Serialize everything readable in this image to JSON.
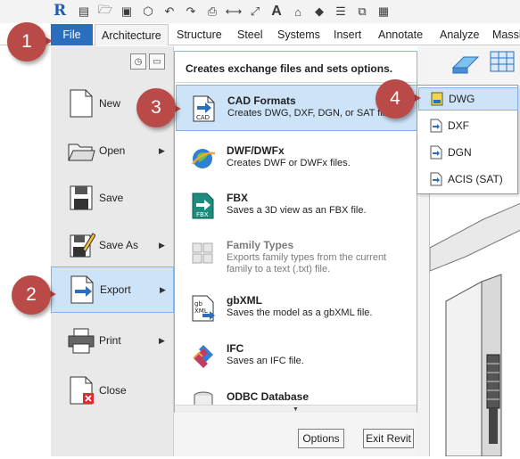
{
  "quick_access": {
    "logo": "R",
    "icons": [
      "open-file-icon",
      "open-folder-icon",
      "save-icon",
      "sync-icon",
      "undo-icon",
      "redo-icon",
      "print-icon",
      "measure-icon",
      "dimension-icon",
      "text-icon",
      "3d-view-icon",
      "section-icon",
      "thin-lines-icon",
      "close-views-icon",
      "switch-windows-icon"
    ]
  },
  "ribbon": {
    "file_tab": "File",
    "tabs": [
      "Architecture",
      "Structure",
      "Steel",
      "Systems",
      "Insert",
      "Annotate",
      "Analyze",
      "Massi"
    ]
  },
  "app_menu": {
    "items": [
      {
        "label": "New",
        "has_arrow": false
      },
      {
        "label": "Open",
        "has_arrow": true
      },
      {
        "label": "Save",
        "has_arrow": false
      },
      {
        "label": "Save As",
        "has_arrow": true
      },
      {
        "label": "Export",
        "has_arrow": true
      },
      {
        "label": "Print",
        "has_arrow": true
      },
      {
        "label": "Close",
        "has_arrow": false
      }
    ],
    "selected": "Export"
  },
  "export_menu": {
    "header": "Creates exchange files and sets options.",
    "items": [
      {
        "title": "CAD Formats",
        "desc": "Creates DWG, DXF, DGN, or SAT files.",
        "selected": true
      },
      {
        "title": "DWF/DWFx",
        "desc": "Creates DWF or DWFx files."
      },
      {
        "title": "FBX",
        "desc": "Saves a 3D view as an FBX file."
      },
      {
        "title": "Family Types",
        "desc": "Exports family types from the current family to a text (.txt) file.",
        "disabled": true
      },
      {
        "title": "gbXML",
        "desc": "Saves the model as a gbXML file."
      },
      {
        "title": "IFC",
        "desc": "Saves an IFC file."
      },
      {
        "title": "ODBC Database",
        "desc": ""
      }
    ]
  },
  "cad_flyout": {
    "items": [
      "DWG",
      "DXF",
      "DGN",
      "ACIS (SAT)"
    ],
    "selected": "DWG"
  },
  "buttons": {
    "options": "Options",
    "exit": "Exit Revit"
  },
  "callouts": [
    "1",
    "2",
    "3",
    "4"
  ],
  "colors": {
    "accent": "#2a6ebd",
    "selection": "#cde3f7",
    "callout": "#b94a47"
  }
}
